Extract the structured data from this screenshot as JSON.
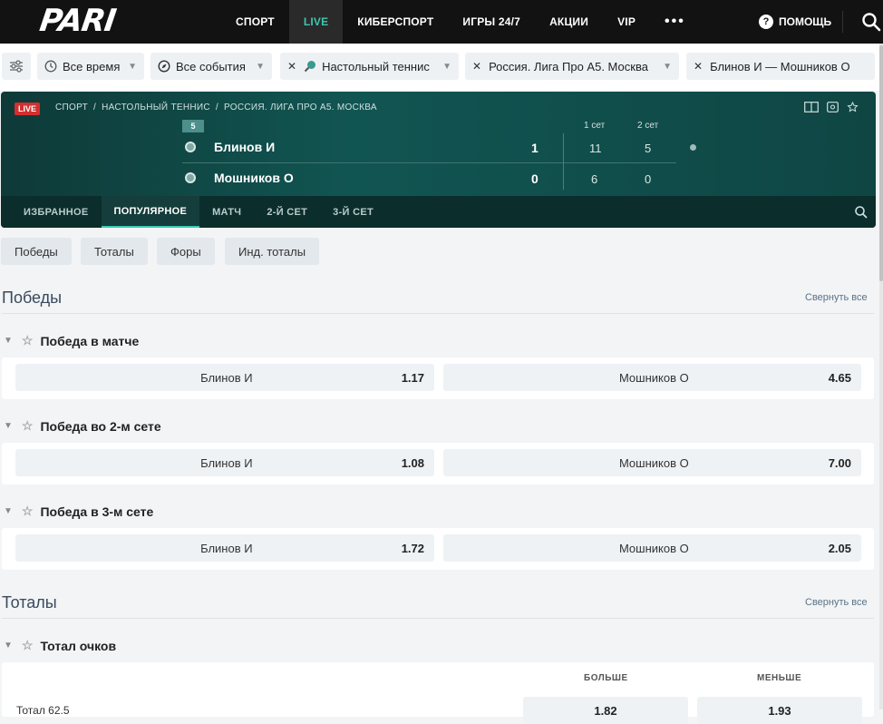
{
  "nav": {
    "logo": "PARI",
    "items": [
      {
        "label": "СПОРТ",
        "active": false
      },
      {
        "label": "LIVE",
        "active": true
      },
      {
        "label": "КИБЕРСПОРТ",
        "active": false
      },
      {
        "label": "ИГРЫ 24/7",
        "active": false
      },
      {
        "label": "АКЦИИ",
        "active": false
      },
      {
        "label": "VIP",
        "active": false
      }
    ],
    "more": "•••",
    "help": "ПОМОЩЬ"
  },
  "filters": {
    "time": "Все время",
    "events": "Все события",
    "sport": "Настольный теннис",
    "league": "Россия. Лига Про А5. Москва",
    "match": "Блинов И — Мошников О"
  },
  "event": {
    "live_badge": "LIVE",
    "breadcrumb": [
      "СПОРТ",
      "/",
      "НАСТОЛЬНЫЙ ТЕННИС",
      "/",
      "РОССИЯ. ЛИГА ПРО А5. МОСКВА"
    ],
    "game_number": "5",
    "set_labels": [
      "1 сет",
      "2 сет"
    ],
    "teams": [
      {
        "name": "Блинов И",
        "score": "1",
        "sets": [
          "11",
          "5"
        ]
      },
      {
        "name": "Мошников О",
        "score": "0",
        "sets": [
          "6",
          "0"
        ]
      }
    ],
    "tabs": [
      {
        "label": "ИЗБРАННОЕ",
        "active": false
      },
      {
        "label": "ПОПУЛЯРНОЕ",
        "active": true
      },
      {
        "label": "МАТЧ",
        "active": false
      },
      {
        "label": "2-Й СЕТ",
        "active": false
      },
      {
        "label": "3-Й СЕТ",
        "active": false
      }
    ]
  },
  "market_filters": [
    "Победы",
    "Тоталы",
    "Форы",
    "Инд. тоталы"
  ],
  "sections": {
    "wins": {
      "title": "Победы",
      "collapse": "Свернуть все",
      "markets": [
        {
          "title": "Победа в матче",
          "p1": "Блинов И",
          "o1": "1.17",
          "p2": "Мошников О",
          "o2": "4.65"
        },
        {
          "title": "Победа во 2-м сете",
          "p1": "Блинов И",
          "o1": "1.08",
          "p2": "Мошников О",
          "o2": "7.00"
        },
        {
          "title": "Победа в 3-м сете",
          "p1": "Блинов И",
          "o1": "1.72",
          "p2": "Мошников О",
          "o2": "2.05"
        }
      ]
    },
    "totals": {
      "title": "Тоталы",
      "collapse": "Свернуть все",
      "market_title": "Тотал очков",
      "col_over": "БОЛЬШЕ",
      "col_under": "МЕНЬШЕ",
      "row_label": "Тотал 62.5",
      "over": "1.82",
      "under": "1.93"
    }
  },
  "colors": {
    "accent": "#3ec7b0",
    "live": "#d32f2f",
    "header_bg": "#115552"
  }
}
